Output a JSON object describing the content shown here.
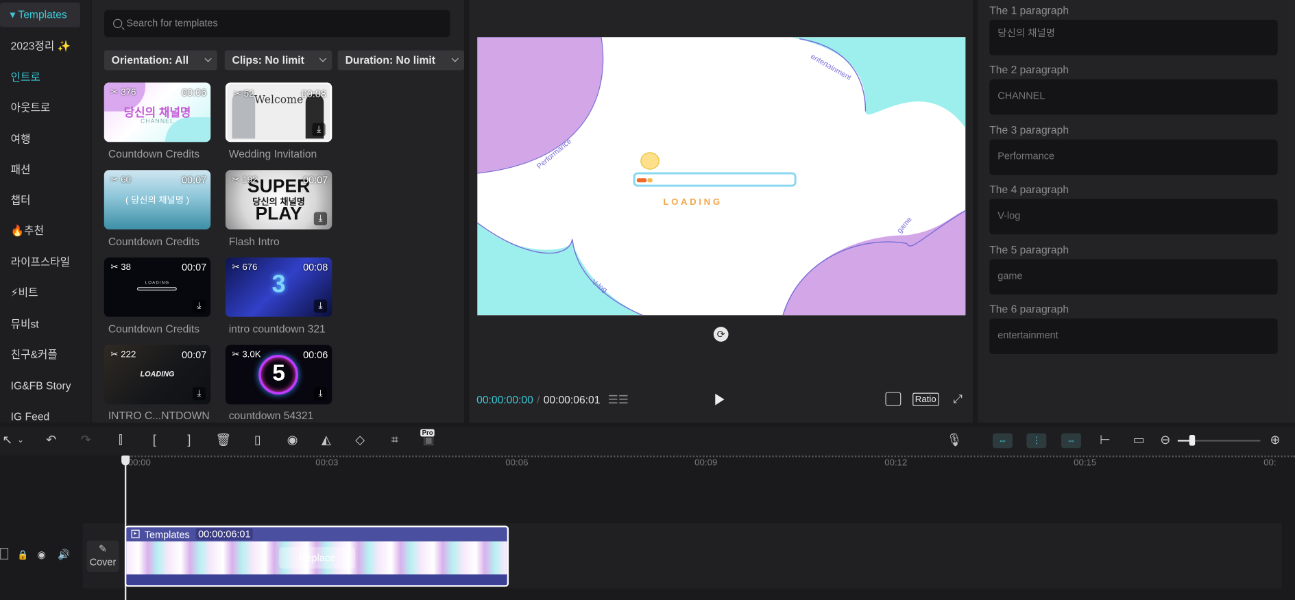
{
  "sidebar": {
    "items": [
      {
        "label": "▾ Templates",
        "active": true
      },
      {
        "label": "2023정리 ✨"
      },
      {
        "label": "인트로",
        "selected": true
      },
      {
        "label": "아웃트로"
      },
      {
        "label": "여행"
      },
      {
        "label": "패션"
      },
      {
        "label": "챕터"
      },
      {
        "label": "🔥추천"
      },
      {
        "label": "라이프스타일"
      },
      {
        "label": "⚡비트"
      },
      {
        "label": "뮤비st"
      },
      {
        "label": "친구&커플"
      },
      {
        "label": "IG&FB Story"
      },
      {
        "label": "IG Feed"
      }
    ]
  },
  "templates": {
    "search_placeholder": "Search for templates",
    "filters": {
      "orientation": "Orientation: All",
      "clips": "Clips: No limit",
      "duration": "Duration: No limit"
    },
    "cards": [
      {
        "title": "Countdown Credits",
        "count": "376",
        "duration": "00:06",
        "thumb_text": "당신의 채널명",
        "thumb_sub": "CHANNEL"
      },
      {
        "title": "Wedding Invitation",
        "count": "52",
        "duration": "00:08",
        "thumb_text": "Welcome"
      },
      {
        "title": "Countdown Credits",
        "count": "60",
        "duration": "00:07",
        "thumb_text": "( 당신의 채널명 )"
      },
      {
        "title": "Flash Intro",
        "count": "192",
        "duration": "00:07",
        "thumb_text": "SUPER",
        "thumb_mid": "당신의 채널명",
        "thumb_sub": "PLAY"
      },
      {
        "title": "Countdown Credits",
        "count": "38",
        "duration": "00:07",
        "thumb_text": "LOADING"
      },
      {
        "title": "intro countdown 321",
        "count": "676",
        "duration": "00:08",
        "thumb_text": "3"
      },
      {
        "title": "INTRO C...NTDOWN",
        "count": "222",
        "duration": "00:07",
        "thumb_text": "LOADING"
      },
      {
        "title": "countdown 54321",
        "count": "3.0K",
        "duration": "00:06",
        "thumb_text": "5"
      }
    ]
  },
  "preview": {
    "current_time": "00:00:00:00",
    "separator": "/",
    "total_time": "00:00:06:01",
    "ratio_label": "Ratio",
    "canvas": {
      "loading_text": "LOADING",
      "word_performance": "Performance",
      "word_entertainment": "entertainment",
      "word_vlog": "V-log",
      "word_game": "game"
    }
  },
  "text_panel": {
    "paragraphs": [
      {
        "label": "The 1 paragraph",
        "value": "당신의 채널명"
      },
      {
        "label": "The 2 paragraph",
        "value": "CHANNEL"
      },
      {
        "label": "The 3 paragraph",
        "value": "Performance"
      },
      {
        "label": "The 4 paragraph",
        "value": "V-log"
      },
      {
        "label": "The 5 paragraph",
        "value": "game"
      },
      {
        "label": "The 6 paragraph",
        "value": "entertainment"
      }
    ]
  },
  "timeline": {
    "pro_badge": "Pro",
    "ruler": [
      "00:00",
      "00:03",
      "00:06",
      "00:09",
      "00:12",
      "00:15",
      "00:"
    ],
    "cover_label": "Cover",
    "clip": {
      "name": "Templates",
      "duration": "00:00:06:01",
      "replace_label": "Replace"
    }
  },
  "colors": {
    "accent": "#3cc9d6",
    "lilac": "#d3a6e8",
    "mint": "#9defee",
    "clip": "#5a5ea8"
  }
}
